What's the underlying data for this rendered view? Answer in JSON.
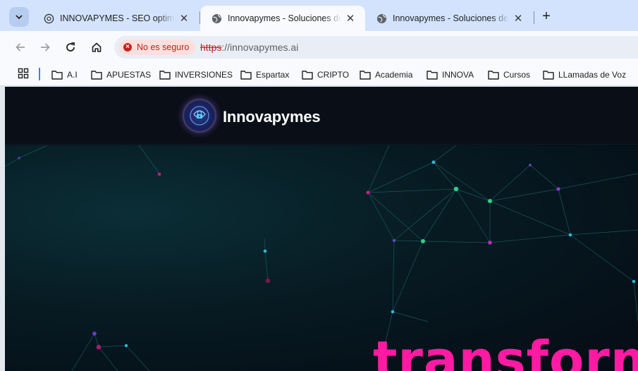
{
  "browser": {
    "tabs": [
      {
        "title": "INNOVAPYMES - SEO optimizado",
        "favicon": "openai-icon",
        "active": false
      },
      {
        "title": "Innovapymes - Soluciones de IA",
        "favicon": "globe-icon",
        "active": true
      },
      {
        "title": "Innovapymes - Soluciones de IA",
        "favicon": "globe-icon",
        "active": false
      }
    ],
    "new_tab": "+",
    "security_chip": "No es seguro",
    "url": {
      "scheme": "https",
      "rest": "://innovapymes.ai"
    },
    "bookmarks": [
      "A.I",
      "APUESTAS",
      "INVERSIONES",
      "Espartax",
      "CRIPTO",
      "Academia",
      "INNOVA",
      "Cursos",
      "LLamadas de Voz"
    ]
  },
  "site": {
    "brand": "Innovapymes",
    "headline": "transforma"
  },
  "colors": {
    "accent": "#ff1aa3",
    "header_bg": "#0a0e17",
    "warning": "#c5221f"
  }
}
